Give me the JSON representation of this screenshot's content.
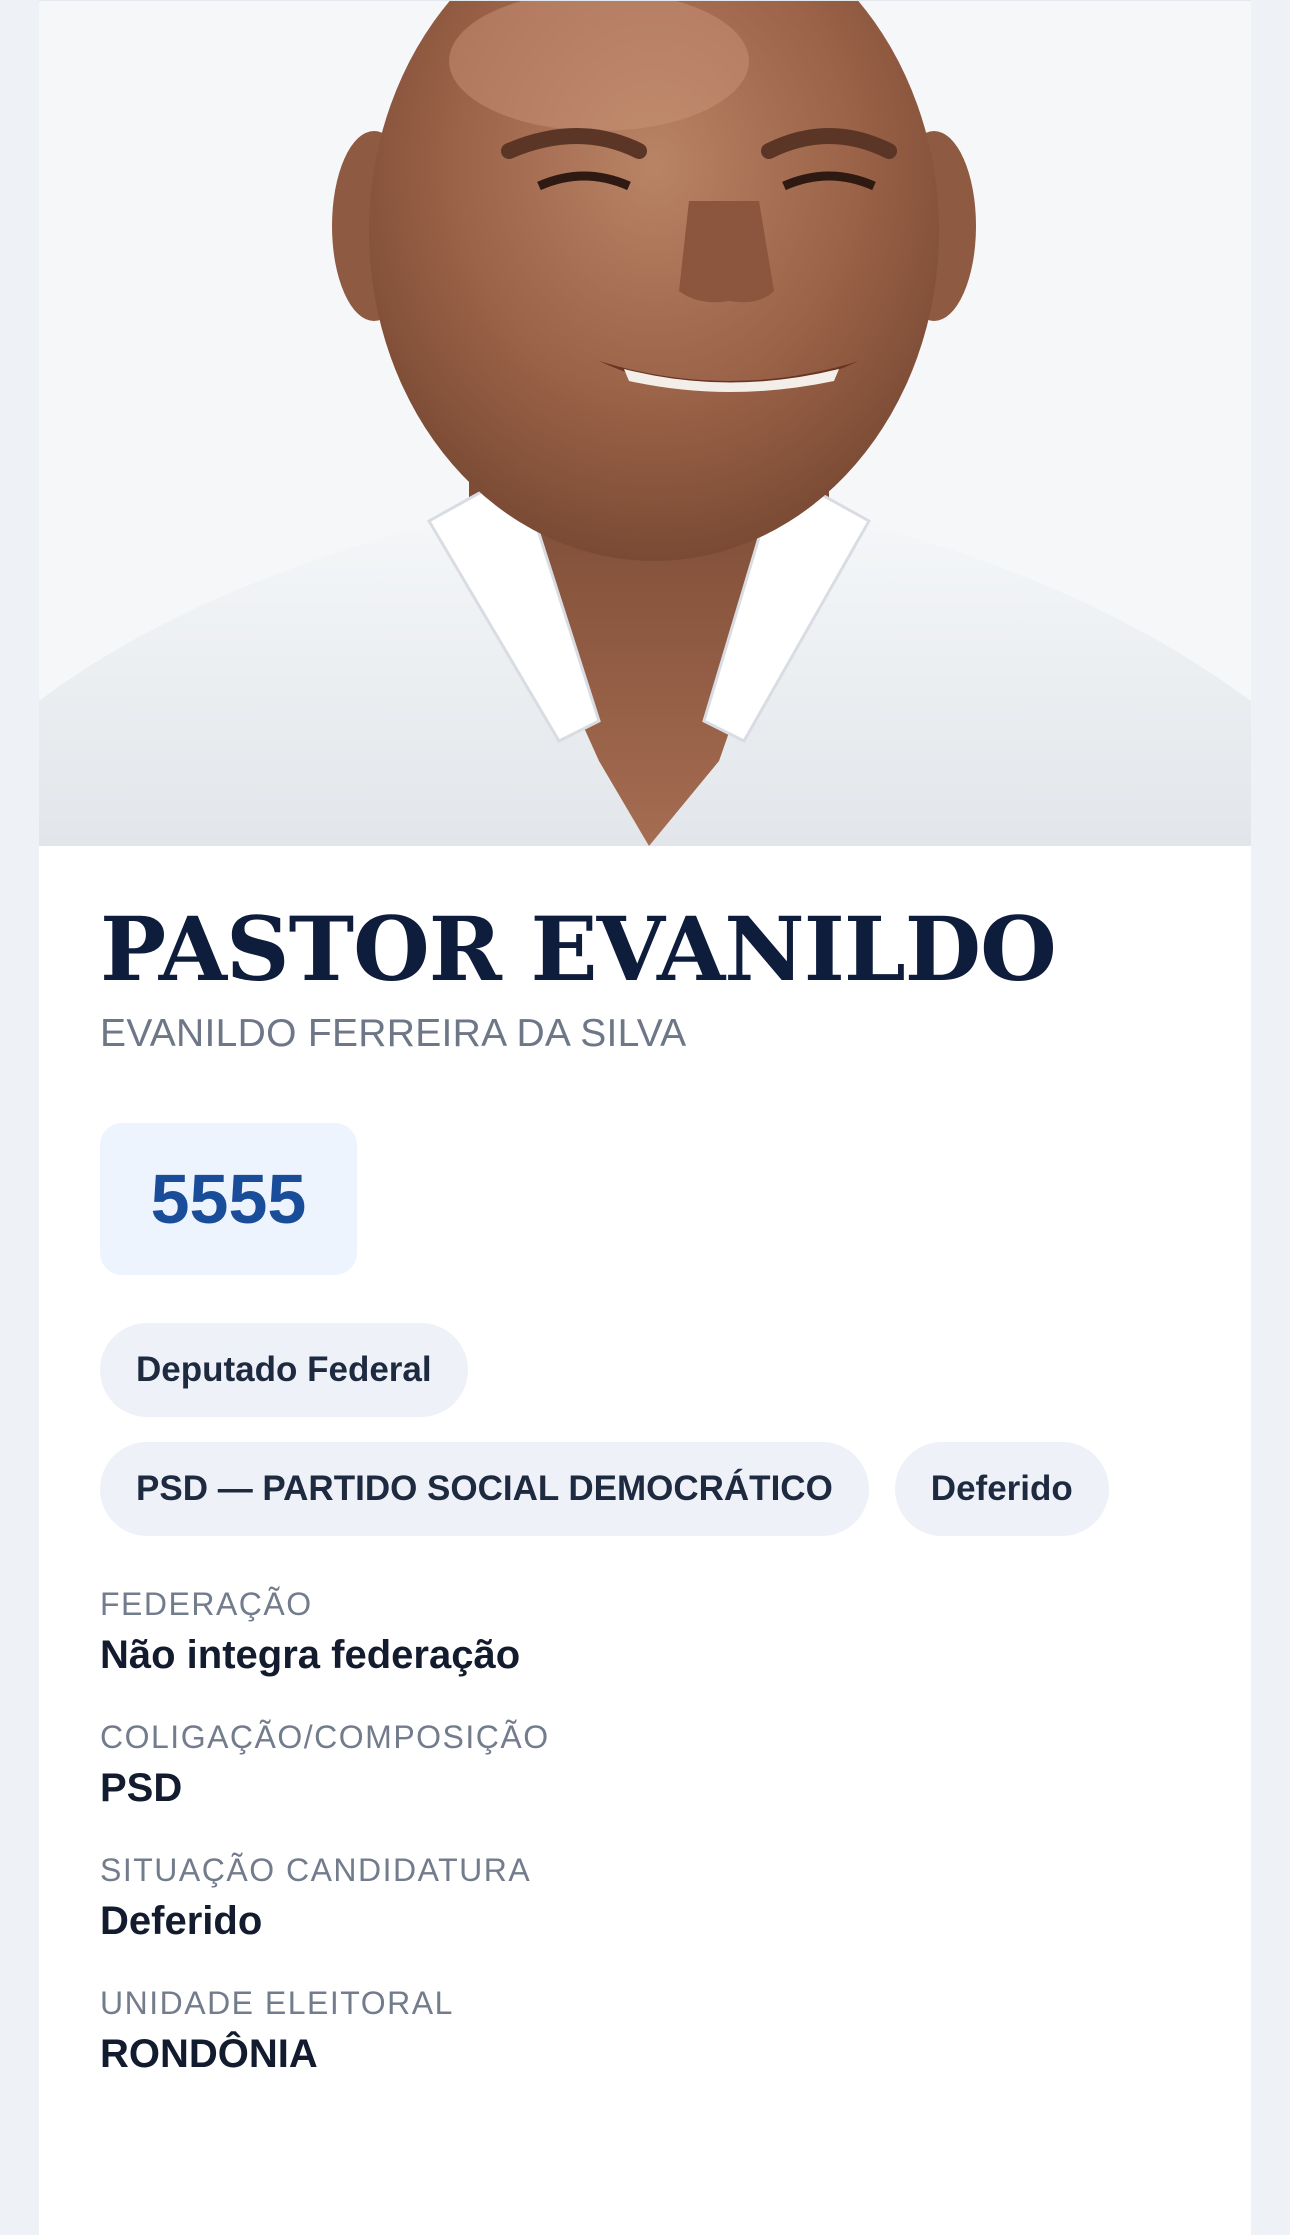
{
  "candidate": {
    "photo_alt": "candidate-photo",
    "display_name": "PASTOR EVANILDO",
    "full_name": "EVANILDO FERREIRA DA SILVA",
    "number": "5555",
    "office": "Deputado Federal",
    "party": "PSD — PARTIDO SOCIAL DEMOCRÁTICO",
    "status_badge": "Deferido"
  },
  "fields": [
    {
      "label": "FEDERAÇÃO",
      "value": "Não integra federação"
    },
    {
      "label": "COLIGAÇÃO/COMPOSIÇÃO",
      "value": "PSD"
    },
    {
      "label": "SITUAÇÃO CANDIDATURA",
      "value": "Deferido"
    },
    {
      "label": "UNIDADE ELEITORAL",
      "value": "RONDÔNIA"
    }
  ],
  "colors": {
    "page_bg": "#eef1f6",
    "card_bg": "#ffffff",
    "name": "#0f1d3d",
    "number": "#1a4d99",
    "number_bg": "#eef4fd",
    "chip_bg": "#eef1f7"
  }
}
